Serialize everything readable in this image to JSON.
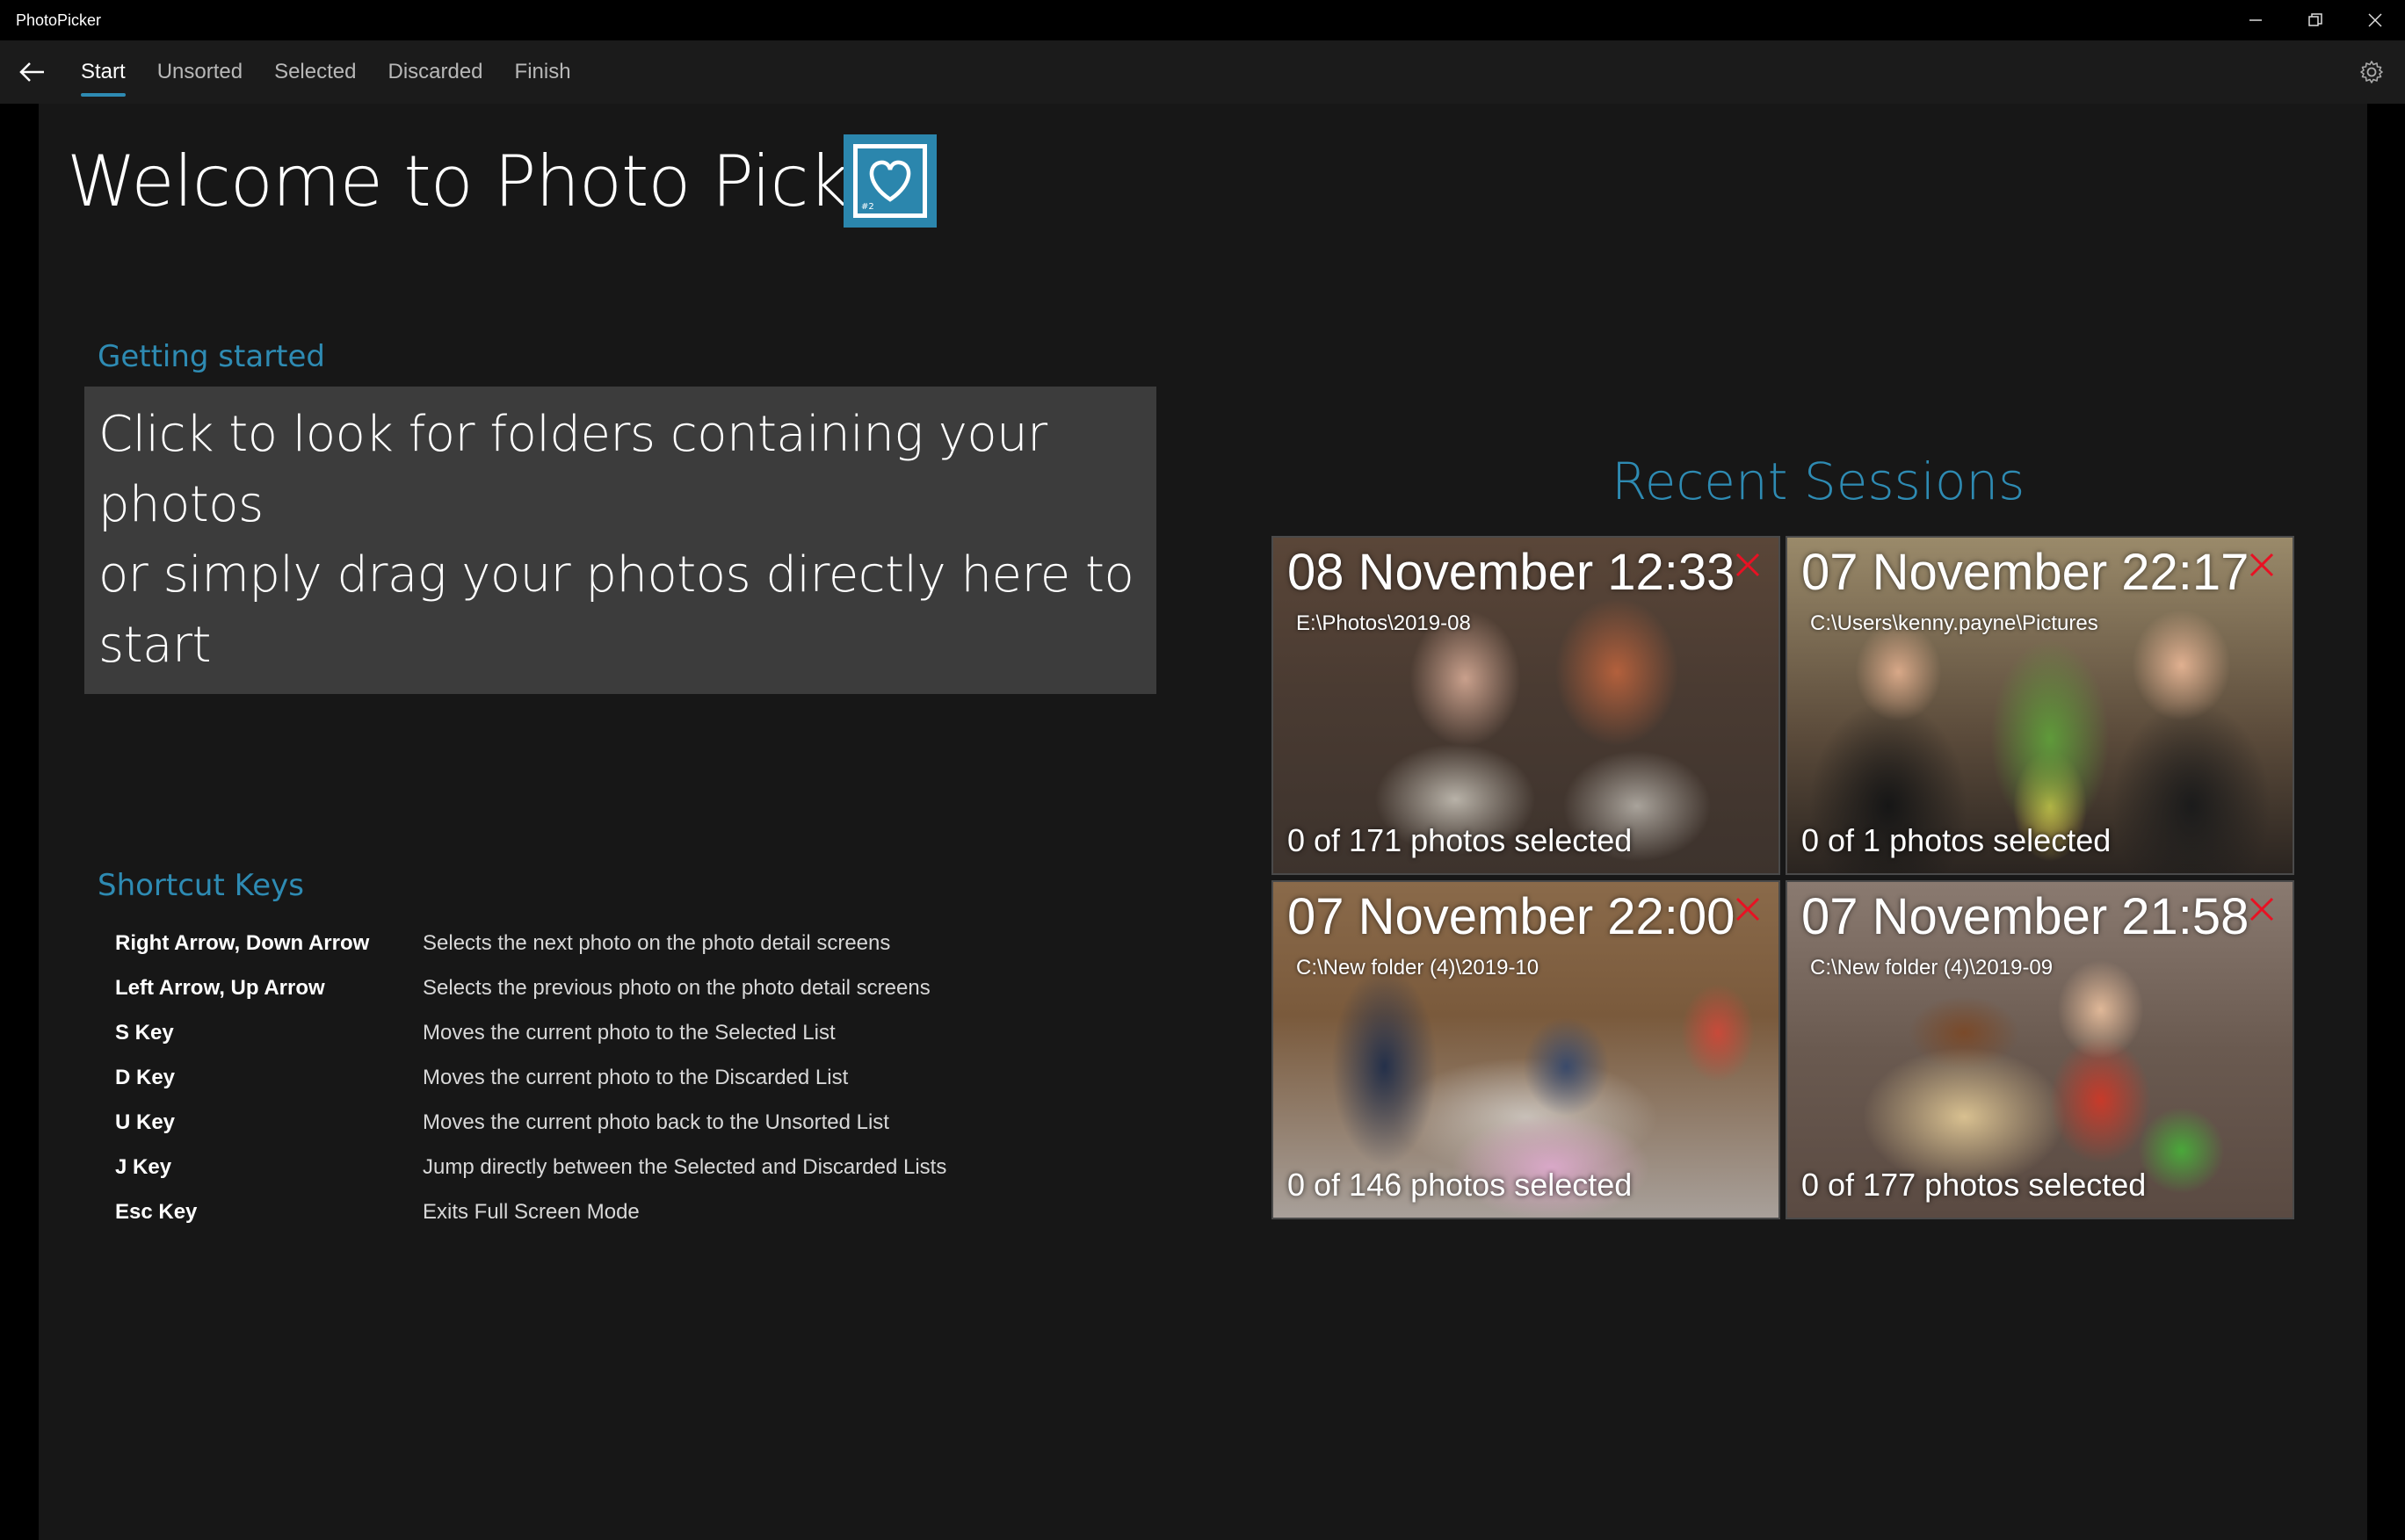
{
  "window": {
    "title": "PhotoPicker"
  },
  "nav": {
    "tabs": [
      {
        "label": "Start",
        "active": true
      },
      {
        "label": "Unsorted",
        "active": false
      },
      {
        "label": "Selected",
        "active": false
      },
      {
        "label": "Discarded",
        "active": false
      },
      {
        "label": "Finish",
        "active": false
      }
    ]
  },
  "welcome": {
    "title": "Welcome to Photo Picker",
    "logo_badge": "#2"
  },
  "getting_started": {
    "title": "Getting started",
    "line1": "Click to look for folders containing your photos",
    "line2": "or simply drag your photos directly here to start"
  },
  "shortcuts": {
    "title": "Shortcut Keys",
    "items": [
      {
        "key": "Right Arrow, Down Arrow",
        "desc": "Selects the next photo on the photo detail screens"
      },
      {
        "key": "Left Arrow, Up Arrow",
        "desc": "Selects the previous photo on the photo detail screens"
      },
      {
        "key": "S Key",
        "desc": "Moves the current photo to the Selected List"
      },
      {
        "key": "D Key",
        "desc": "Moves the current photo to the Discarded List"
      },
      {
        "key": "U Key",
        "desc": "Moves the current photo back to the Unsorted List"
      },
      {
        "key": "J Key",
        "desc": "Jump directly between the Selected and Discarded Lists"
      },
      {
        "key": "Esc Key",
        "desc": "Exits Full Screen Mode"
      }
    ]
  },
  "recent": {
    "title": "Recent Sessions",
    "sessions": [
      {
        "date": "08 November 12:33",
        "path": "E:\\Photos\\2019-08",
        "count": "0 of 171 photos selected"
      },
      {
        "date": "07 November 22:17",
        "path": "C:\\Users\\kenny.payne\\Pictures",
        "count": "0 of 1 photos selected"
      },
      {
        "date": "07 November 22:00",
        "path": "C:\\New folder (4)\\2019-10",
        "count": "0 of 146 photos selected"
      },
      {
        "date": "07 November 21:58",
        "path": "C:\\New folder (4)\\2019-09",
        "count": "0 of 177 photos selected"
      }
    ]
  },
  "colors": {
    "accent": "#2e8bb3",
    "close_red": "#e81123",
    "panel_bg": "#171717",
    "box_bg": "#3c3c3c"
  }
}
